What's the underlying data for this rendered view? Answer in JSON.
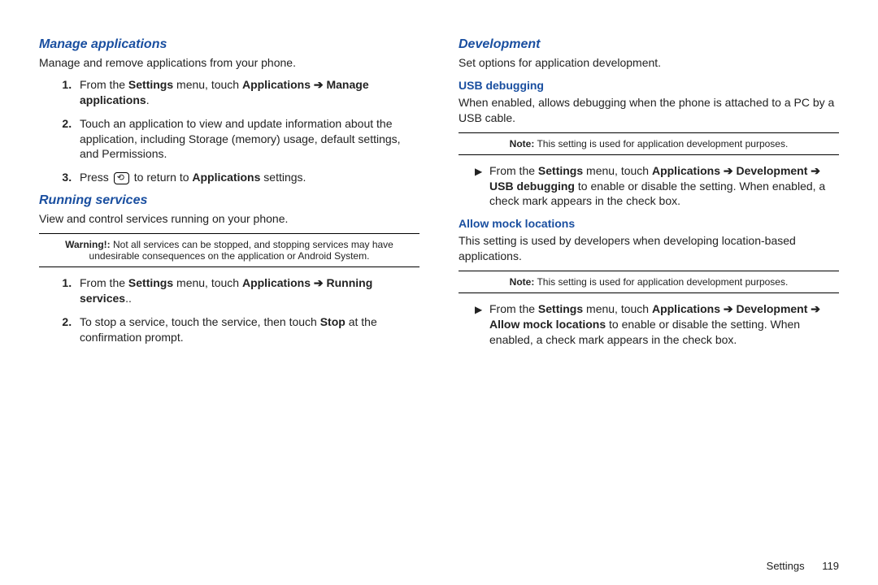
{
  "left": {
    "manage": {
      "heading": "Manage applications",
      "intro": "Manage and remove applications from your phone.",
      "step1_pre": "From the ",
      "step1_settings": "Settings",
      "step1_mid": " menu, touch ",
      "step1_apps": "Applications ➔ Manage applications",
      "step1_post": ".",
      "step2": "Touch an application to view and update information about the application, including Storage (memory) usage, default settings, and Permissions.",
      "step3_pre": "Press ",
      "step3_post": " to return to ",
      "step3_apps": "Applications",
      "step3_end": " settings."
    },
    "running": {
      "heading": "Running services",
      "intro": "View and control services running on your phone.",
      "warn_label": "Warning!:",
      "warn_text": " Not all services can be stopped, and stopping services may have undesirable consequences on the application or Android System.",
      "step1_pre": "From the ",
      "step1_settings": "Settings",
      "step1_mid": " menu, touch ",
      "step1_path": "Applications ➔ Running services",
      "step1_post": "..",
      "step2_pre": "To stop a service, touch the service, then touch ",
      "step2_stop": "Stop",
      "step2_post": " at the confirmation prompt."
    }
  },
  "right": {
    "dev": {
      "heading": "Development",
      "intro": "Set options for application development."
    },
    "usb": {
      "heading": "USB debugging",
      "intro": "When enabled, allows debugging when the phone is attached to a PC by a USB cable.",
      "note_label": "Note:",
      "note_text": " This setting is used for application development purposes.",
      "b_pre": "From the ",
      "b_settings": "Settings",
      "b_mid": " menu, touch ",
      "b_path": "Applications ➔ Development ➔ USB debugging",
      "b_post": "  to enable or disable the setting. When enabled, a check mark appears in the check box."
    },
    "mock": {
      "heading": "Allow mock locations",
      "intro": "This setting is used by developers when developing location-based applications.",
      "note_label": "Note:",
      "note_text": " This setting is used for application development purposes.",
      "b_pre": "From the ",
      "b_settings": "Settings",
      "b_mid": " menu, touch ",
      "b_path": "Applications ➔ Development ➔ Allow mock locations",
      "b_post": " to enable or disable the setting. When enabled, a check mark appears in the check box."
    }
  },
  "footer": {
    "section": "Settings",
    "page": "119"
  },
  "icons": {
    "return_glyph": "⟲",
    "bullet_glyph": "▶"
  }
}
